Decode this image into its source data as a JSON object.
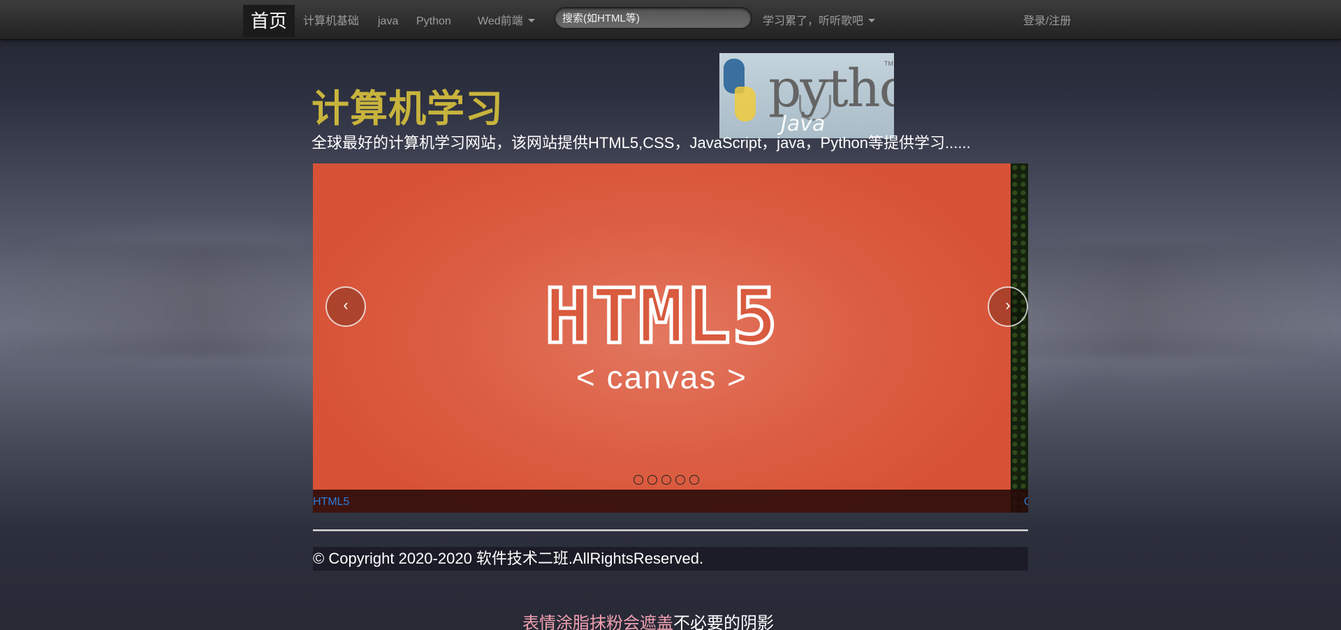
{
  "navbar": {
    "brand": "首页",
    "items": [
      {
        "label": "计算机基础"
      },
      {
        "label": "java"
      },
      {
        "label": "Python"
      },
      {
        "label": "Wed前端"
      }
    ],
    "search_placeholder": "搜索(如HTML等)",
    "music_dropdown": "学习累了，听听歌吧",
    "login": "登录/注册"
  },
  "logo": {
    "python_text": "python",
    "java_text": "Java",
    "tm": "TM"
  },
  "header": {
    "title": "计算机学习",
    "subtitle": "全球最好的计算机学习网站，该网站提供HTML5,CSS，JavaScript，java，Python等提供学习......"
  },
  "carousel": {
    "slide_heading": "HTML5",
    "slide_sub": "< canvas >",
    "prev": "‹",
    "next": "›",
    "indicator_count": 5,
    "caption": "HTML5",
    "next_caption": "C"
  },
  "footer": {
    "copyright": "© Copyright 2020-2020 软件技术二班.AllRightsReserved."
  },
  "bottom": {
    "pink_text": "表情涂脂抹粉会遮盖",
    "white_text": "不必要的阴影"
  },
  "colors": {
    "title": "#c8b43d",
    "slide_bg": "#dc5f43",
    "caption_link": "#2d7fd6",
    "bottom_pink": "#f0a0b0"
  }
}
